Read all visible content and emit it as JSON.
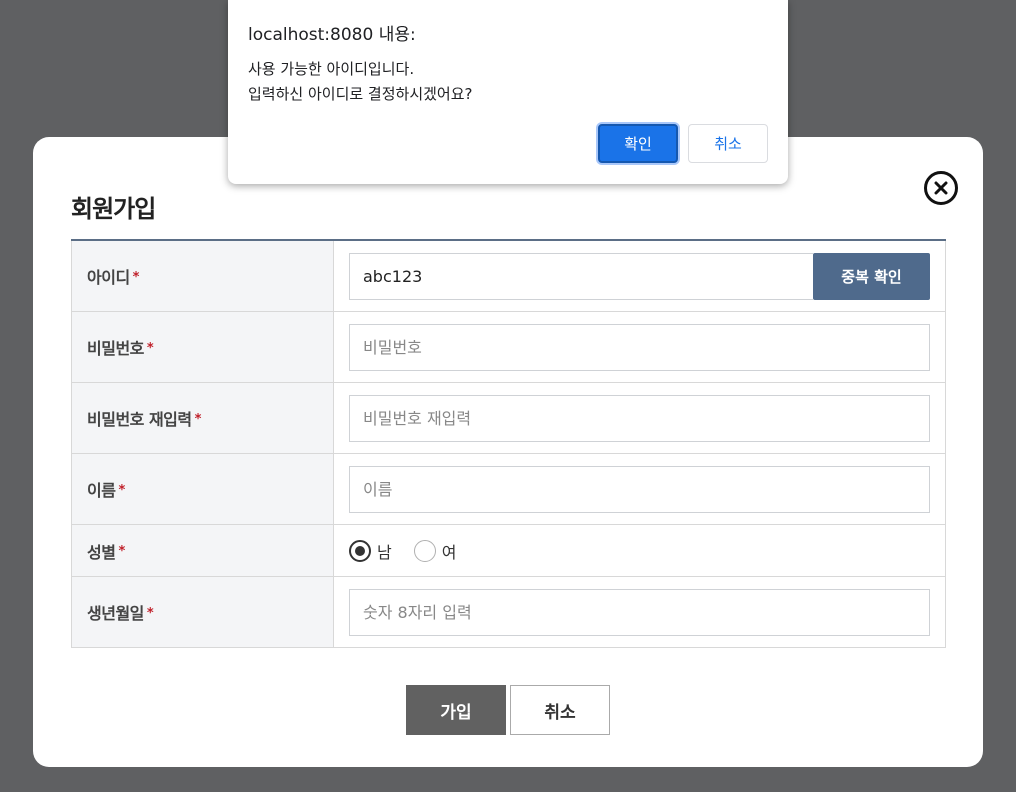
{
  "modal": {
    "title": "회원가입",
    "close_icon": "close-circle-icon"
  },
  "form": {
    "required_mark": "*",
    "id": {
      "label": "아이디",
      "value": "abc123",
      "dup_button": "중복 확인"
    },
    "password": {
      "label": "비밀번호",
      "placeholder": "비밀번호"
    },
    "password_confirm": {
      "label": "비밀번호 재입력",
      "placeholder": "비밀번호 재입력"
    },
    "name": {
      "label": "이름",
      "placeholder": "이름"
    },
    "gender": {
      "label": "성별",
      "options": [
        "남",
        "여"
      ],
      "selected": "남"
    },
    "birth": {
      "label": "생년월일",
      "placeholder": "숫자 8자리 입력"
    }
  },
  "buttons": {
    "join": "가입",
    "cancel": "취소"
  },
  "alert": {
    "title": "localhost:8080 내용:",
    "message_line1": "사용 가능한 아이디입니다.",
    "message_line2": "입력하신 아이디로 결정하시겠어요?",
    "ok": "확인",
    "cancel": "취소"
  },
  "colors": {
    "overlay": "#5f6062",
    "header_rule": "#5b6e86",
    "dup_button": "#4f6a8c",
    "join_button": "#616161",
    "required_star": "#c0202a",
    "alert_primary": "#1a73e8"
  }
}
